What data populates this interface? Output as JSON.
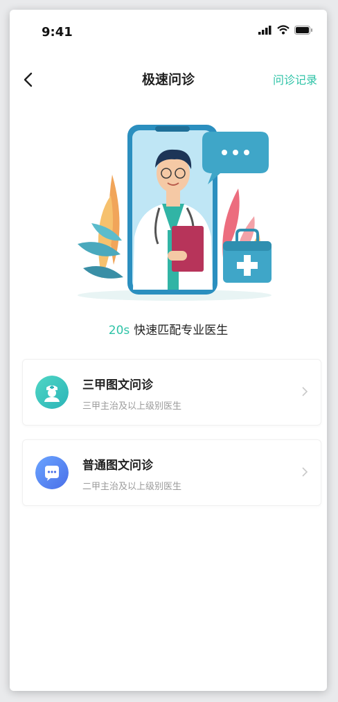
{
  "status_bar": {
    "time": "9:41"
  },
  "nav": {
    "title": "极速问诊",
    "record_label": "问诊记录"
  },
  "hero": {
    "tagline_highlight": "20s",
    "tagline_text": "快速匹配专业医生"
  },
  "options": [
    {
      "name": "三甲图文问诊",
      "desc": "三甲主治及以上级别医生",
      "icon": "nurse-icon"
    },
    {
      "name": "普通图文问诊",
      "desc": "二甲主治及以上级别医生",
      "icon": "chat-bubble-icon"
    }
  ],
  "colors": {
    "accent": "#2ec3a7",
    "teal_icon": "#3cc9bc",
    "blue_icon": "#5b86f5"
  }
}
